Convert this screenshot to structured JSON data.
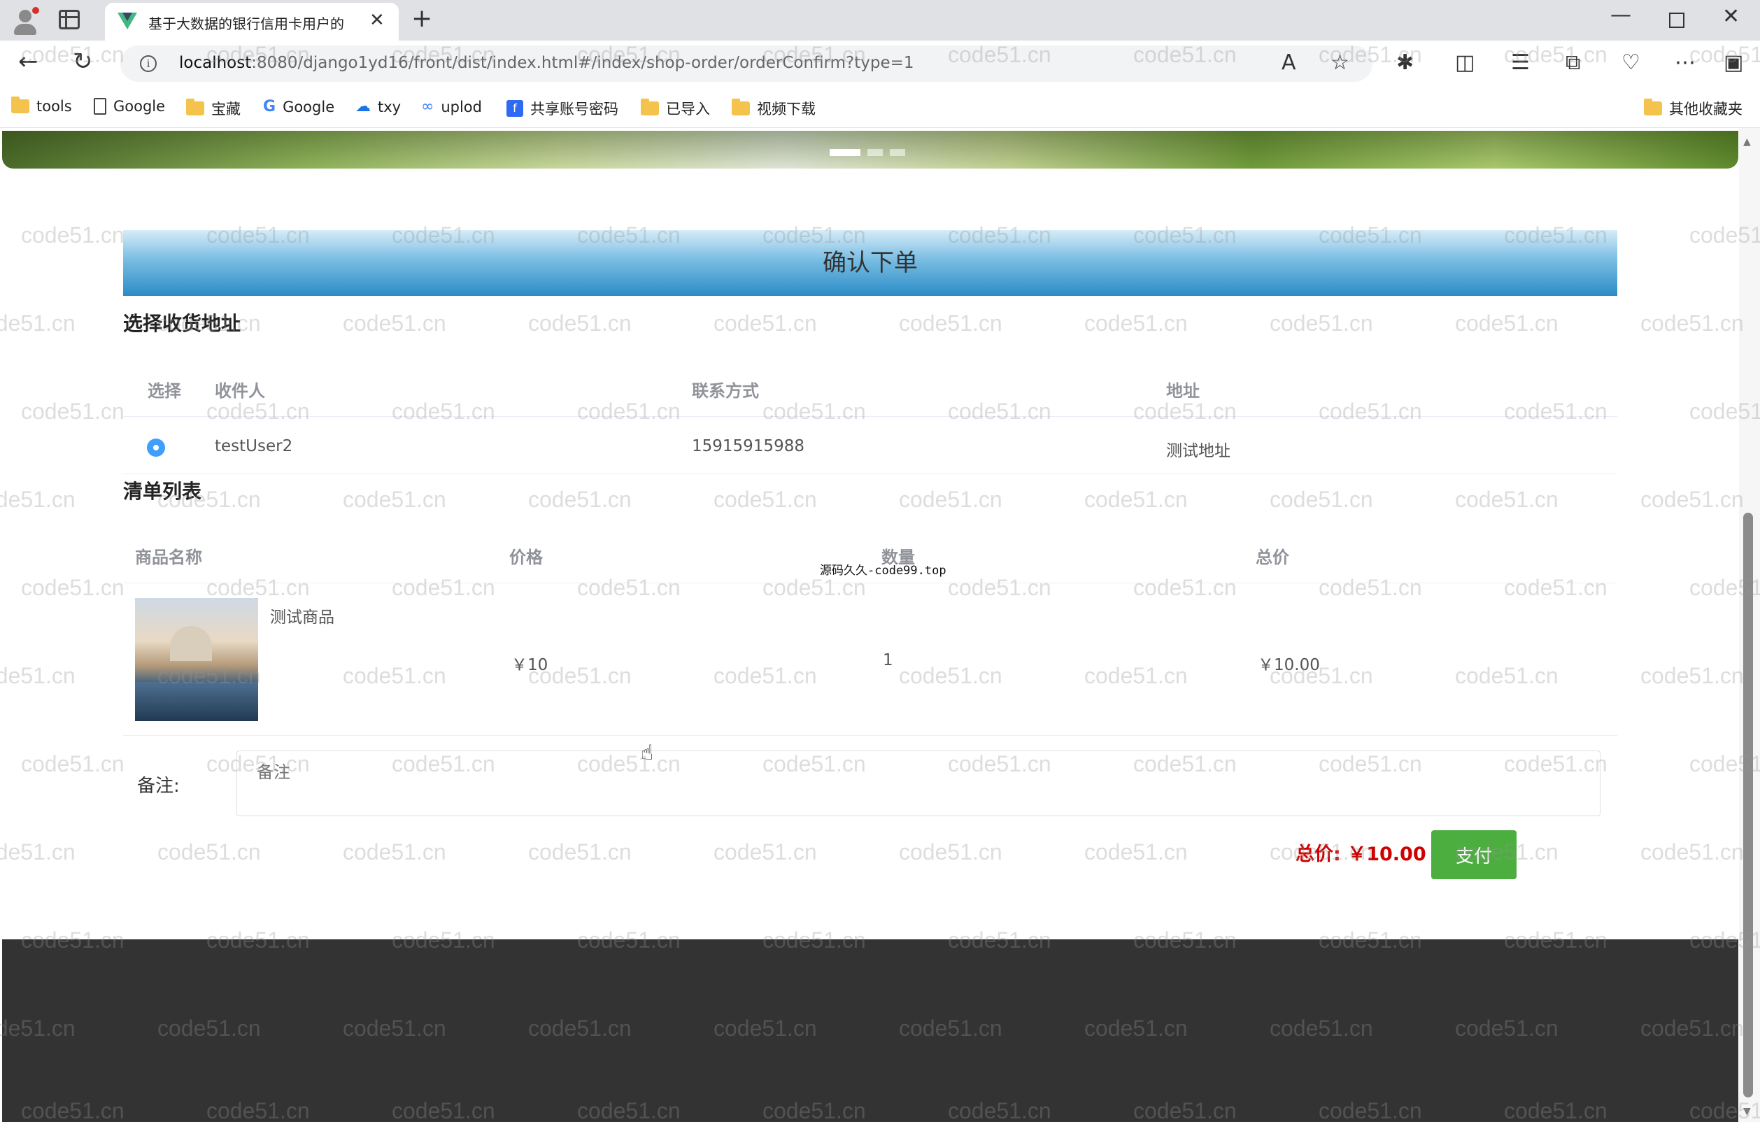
{
  "browser": {
    "tab_title": "基于大数据的银行信用卡用户的",
    "url_host": "localhost",
    "url_rest": ":8080/django1yd16/front/dist/index.html#/index/shop-order/orderConfirm?type=1",
    "bookmarks": [
      "tools",
      "Google",
      "宝藏",
      "Google",
      "txy",
      "uplod",
      "共享账号密码",
      "已导入",
      "视频下载"
    ],
    "other_bookmarks": "其他收藏夹"
  },
  "page": {
    "header_title": "确认下单",
    "address_section_title": "选择收货地址",
    "address_columns": [
      "选择",
      "收件人",
      "联系方式",
      "地址"
    ],
    "address_row": {
      "recipient": "testUser2",
      "phone": "15915915988",
      "address": "测试地址"
    },
    "items_section_title": "清单列表",
    "item_columns": [
      "商品名称",
      "价格",
      "数量",
      "总价"
    ],
    "item_row": {
      "name": "测试商品",
      "price": "￥10",
      "quantity": "1",
      "subtotal": "￥10.00"
    },
    "remark_label": "备注:",
    "remark_placeholder": "备注",
    "total_label": "总价: ￥10.00",
    "pay_button": "支付",
    "overlay_text": "源码久久-code99.top"
  },
  "watermark": "code51.cn",
  "colors": {
    "accent_blue": "#2b8cc6",
    "radio_blue": "#409eff",
    "total_red": "#d00000",
    "pay_green": "#4cae3f",
    "footer": "#333333"
  }
}
